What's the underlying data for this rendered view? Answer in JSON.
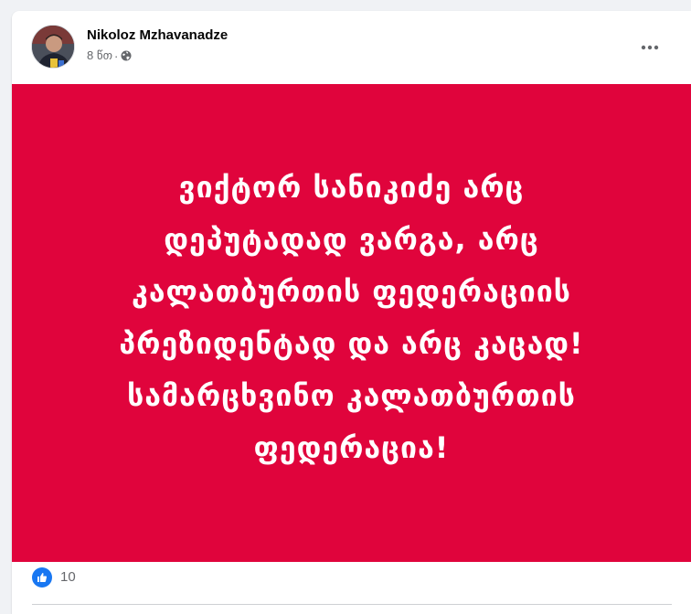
{
  "post": {
    "author": "Nikoloz Mzhavanadze",
    "time": "8 წთ",
    "separator": "·",
    "visibility_icon": "globe-icon",
    "more_icon": "more-horizontal-icon",
    "image_background": "#e0043c",
    "image_text_lines": [
      "ვიქტორ სანიკიძე არც",
      "დეპუტადად ვარგა, არც",
      "კალათბურთის ფედერაციის",
      "პრეზიდენტად და არც კაცად!",
      "სამარცხვინო კალათბურთის",
      "ფედერაცია!"
    ],
    "reactions": {
      "icon": "like-icon",
      "count": "10"
    }
  }
}
